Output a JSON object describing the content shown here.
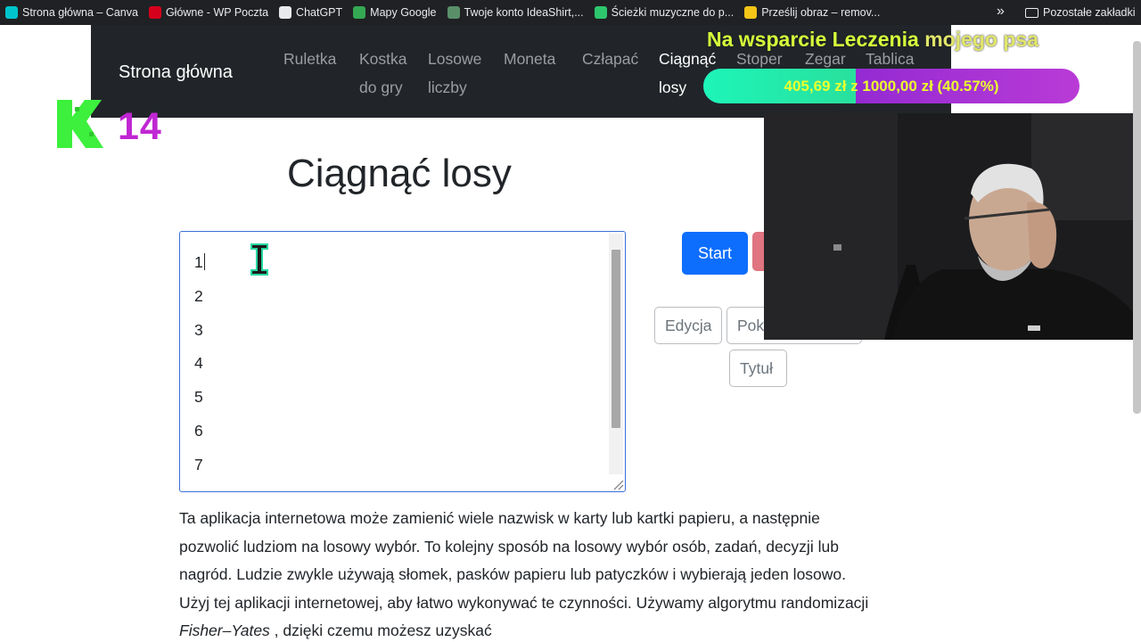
{
  "bookmarks": {
    "items": [
      {
        "label": "Strona główna – Canva",
        "icon": "canva-icon",
        "color": "#00c4cc"
      },
      {
        "label": "Główne - WP Poczta",
        "icon": "wp-icon",
        "color": "#d6001c"
      },
      {
        "label": "ChatGPT",
        "icon": "chatgpt-icon",
        "color": "#e8eaed"
      },
      {
        "label": "Mapy Google",
        "icon": "maps-pin-icon",
        "color": "#34a853"
      },
      {
        "label": "Twoje konto IdeaShirt,...",
        "icon": "shirt-icon",
        "color": "#5a8f6a"
      },
      {
        "label": "Ścieżki muzyczne do p...",
        "icon": "pixabay-icon",
        "color": "#2ec66d"
      },
      {
        "label": "Prześlij obraz – remov...",
        "icon": "remove-bg-icon",
        "color": "#f5c518"
      }
    ],
    "more": "»",
    "folder": "Pozostałe zakładki"
  },
  "navbar": {
    "brand": "Strona główna",
    "items": [
      {
        "line1": "Ruletka",
        "line2": ""
      },
      {
        "line1": "Kostka",
        "line2": "do gry"
      },
      {
        "line1": "Losowe",
        "line2": "liczby"
      },
      {
        "line1": "Moneta",
        "line2": ""
      },
      {
        "line1": "Człapać",
        "line2": ""
      },
      {
        "line1": "Ciągnąć",
        "line2": "losy"
      },
      {
        "line1": "Stoper",
        "line2": ""
      },
      {
        "line1": "Zegar",
        "line2": ""
      },
      {
        "line1": "Tablica",
        "line2": ""
      }
    ]
  },
  "logo": {
    "number": "14"
  },
  "donation": {
    "title_main": "Na wsparcie Leczenia ",
    "title_rest": "mojego psa",
    "progress_text": "405,69 zł z 1000,00 zł (40.57%)",
    "progress_fraction": 0.4057
  },
  "main": {
    "title": "Ciągnąć losy",
    "entries": [
      "1",
      "2",
      "3",
      "4",
      "5",
      "6",
      "7"
    ],
    "start_button": "Start",
    "edit_button": "Edycja",
    "show_button_partial": "Pok",
    "title_button": "Tytuł",
    "description_parts": [
      "Ta aplikacja internetowa może zamienić wiele nazwisk w karty lub kartki papieru, a następnie pozwolić ludziom na losowy wybór. To kolejny sposób na losowy wybór osób, zadań, decyzji lub nagród. Ludzie zwykle używają słomek, pasków papieru lub patyczków i wybierają jeden losowo. Użyj tej aplikacji internetowej, aby łatwo wykonywać te czynności. Używamy algorytmu randomizacji ",
      "Fisher–Yates",
      " , dzięki czemu możesz uzyskać"
    ]
  },
  "colors": {
    "navbar_bg": "#212529",
    "primary": "#0d6efd",
    "donation_title": "#d6ff3b",
    "progress_fill": "#1df5b8",
    "progress_track": "#8a2be2",
    "logo_green": "#3df03d",
    "logo_magenta": "#c026d3"
  }
}
